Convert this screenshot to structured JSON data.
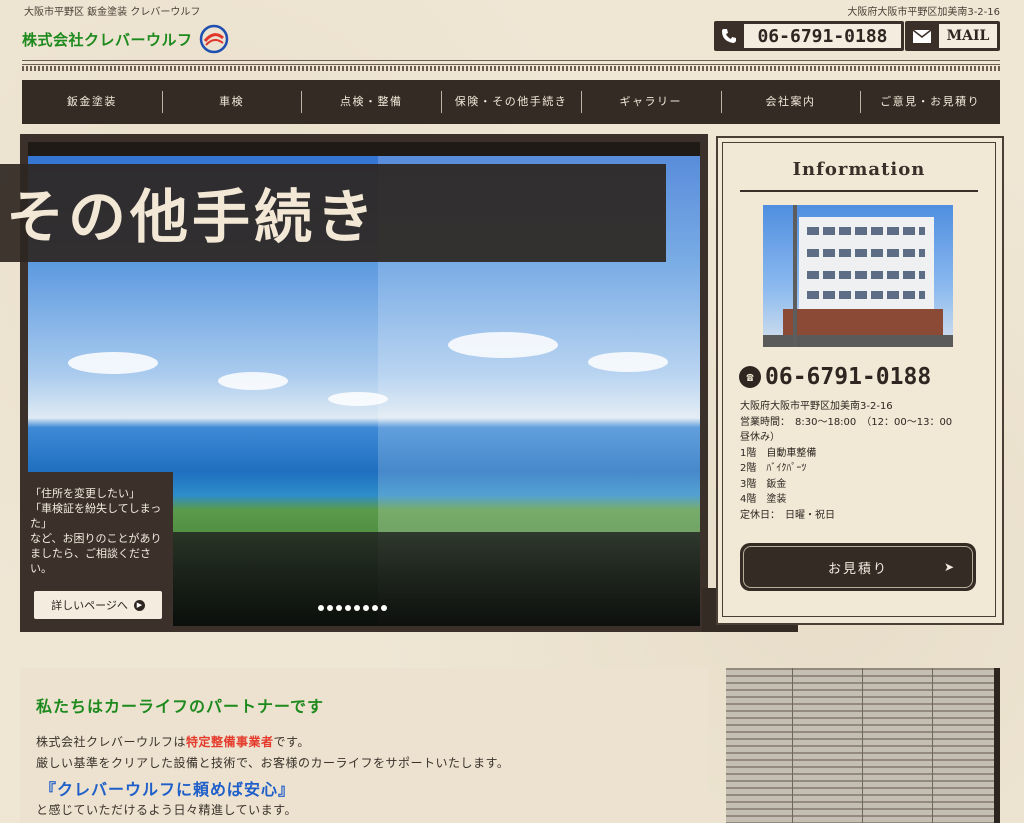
{
  "header": {
    "tagline": "大阪市平野区 鈑金塗装 クレバーウルフ",
    "address_top": "大阪府大阪市平野区加美南3-2-16",
    "logo_text": "株式会社クレバーウルフ",
    "phone": "06-6791-0188",
    "mail_label": "MAIL"
  },
  "nav": {
    "items": [
      "鈑金塗装",
      "車検",
      "点検・整備",
      "保険・その他手続き",
      "ギャラリー",
      "会社案内",
      "ご意見・お見積り"
    ]
  },
  "slider": {
    "title": "その他手続き",
    "caption": "「住所を変更したい」\n「車検証を紛失してしまった」\nなど、お困りのことがありましたら、ご相談ください。",
    "more_button": "詳しいページへ",
    "dot_count": 8,
    "prev_glyph": "‹",
    "next_glyph": "›"
  },
  "info": {
    "title": "Information",
    "phone": "06-6791-0188",
    "lines": [
      "大阪府大阪市平野区加美南3-2-16",
      "営業時間：　8:30〜18:00　（12：00〜13：00",
      "昼休み）",
      "1階　自動車整備",
      "2階　ﾊﾞｲｸﾊﾟｰﾂ",
      "3階　鈑金",
      "4階　塗装",
      "定休日：　日曜・祝日"
    ],
    "quote_button": "お見積り"
  },
  "lower": {
    "heading": "私たちはカーライフのパートナーです",
    "line1_prefix": "株式会社クレバーウルフは",
    "line1_red": "特定整備事業者",
    "line1_suffix": "です。",
    "line2": "厳しい基準をクリアした設備と技術で、お客様のカーライフをサポートいたします。",
    "line3": "『クレバーウルフに頼めば安心』",
    "line4": "と感じていただけるよう日々精進しています。"
  },
  "colors": {
    "background": "#efe6d4",
    "dark_brown": "#352b25",
    "logo_green": "#1d8a1d",
    "accent_red": "#e53b2d",
    "accent_blue": "#1f5fc9"
  }
}
